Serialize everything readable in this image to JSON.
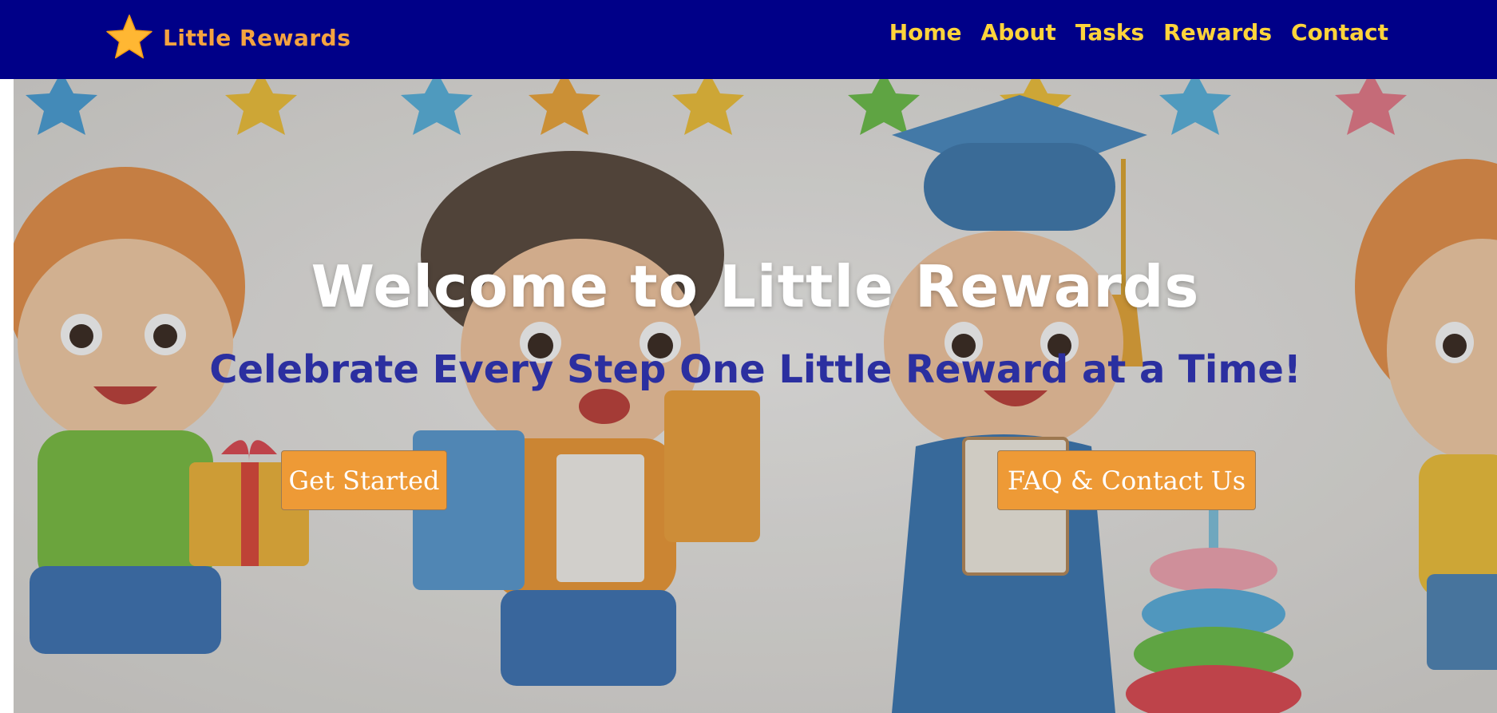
{
  "header": {
    "brand_name": "Little Rewards",
    "logo_icon": "star-icon",
    "brand_color": "#f5a340",
    "background": "#000088",
    "nav_color": "#ffd43b",
    "nav": [
      {
        "label": "Home"
      },
      {
        "label": "About"
      },
      {
        "label": "Tasks"
      },
      {
        "label": "Rewards"
      },
      {
        "label": "Contact"
      }
    ]
  },
  "hero": {
    "title": "Welcome to Little Rewards",
    "subtitle": "Celebrate Every Step One Little Reward at a Time!",
    "subtitle_color": "#2b2fa0",
    "background_image": "cartoon-kids-celebration-illustration",
    "buttons": {
      "get_started": "Get Started",
      "faq_contact": "FAQ & Contact Us"
    },
    "button_color": "#ee9a36"
  }
}
